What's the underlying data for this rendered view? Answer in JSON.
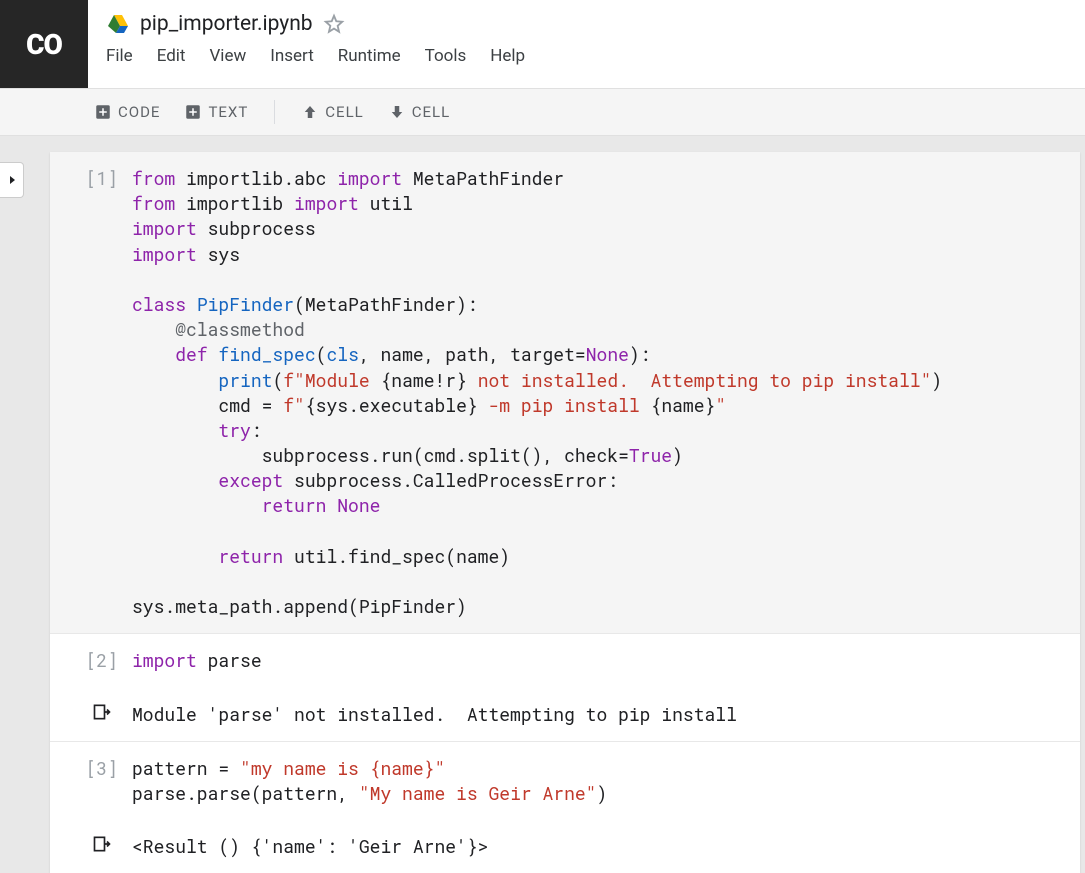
{
  "header": {
    "title": "pip_importer.ipynb",
    "logo": "CO"
  },
  "menubar": {
    "file": "File",
    "edit": "Edit",
    "view": "View",
    "insert": "Insert",
    "runtime": "Runtime",
    "tools": "Tools",
    "help": "Help"
  },
  "toolbar": {
    "code": "CODE",
    "text": "TEXT",
    "cell_up": "CELL",
    "cell_down": "CELL"
  },
  "cells": {
    "c1": {
      "prompt": "[1]"
    },
    "c2": {
      "prompt": "[2]"
    },
    "c2out": {
      "text": "Module 'parse' not installed.  Attempting to pip install"
    },
    "c3": {
      "prompt": "[3]"
    },
    "c3out": {
      "text": "<Result () {'name': 'Geir Arne'}>"
    }
  },
  "code": {
    "c1_l1_kw1": "from",
    "c1_l1_mod": " importlib.abc ",
    "c1_l1_kw2": "import",
    "c1_l1_name": " MetaPathFinder",
    "c1_l2_kw1": "from",
    "c1_l2_mod": " importlib ",
    "c1_l2_kw2": "import",
    "c1_l2_name": " util",
    "c1_l3_kw": "import",
    "c1_l3_name": " subprocess",
    "c1_l4_kw": "import",
    "c1_l4_name": " sys",
    "c1_l6_kw": "class",
    "c1_l6_name": " PipFinder",
    "c1_l6_rest": "(MetaPathFinder):",
    "c1_l7": "    @classmethod",
    "c1_l8_pad": "    ",
    "c1_l8_kw": "def",
    "c1_l8_name": " find_spec",
    "c1_l8_sig1": "(",
    "c1_l8_cls": "cls",
    "c1_l8_sig2": ", name, path, target=",
    "c1_l8_none": "None",
    "c1_l8_sig3": "):",
    "c1_l9_pad": "        ",
    "c1_l9_fn": "print",
    "c1_l9_p1": "(",
    "c1_l9_f": "f",
    "c1_l9_s1": "\"Module ",
    "c1_l9_i1": "{name!r}",
    "c1_l9_s2": " not installed.  Attempting to pip install\"",
    "c1_l9_p2": ")",
    "c1_l10_pad": "        ",
    "c1_l10_lhs": "cmd = ",
    "c1_l10_f": "f",
    "c1_l10_s1": "\"",
    "c1_l10_i1": "{sys.executable}",
    "c1_l10_s2": " -m pip install ",
    "c1_l10_i2": "{name}",
    "c1_l10_s3": "\"",
    "c1_l11_pad": "        ",
    "c1_l11_kw": "try",
    "c1_l11_c": ":",
    "c1_l12_pad": "            ",
    "c1_l12_body": "subprocess.run(cmd.split(), check=",
    "c1_l12_true": "True",
    "c1_l12_end": ")",
    "c1_l13_pad": "        ",
    "c1_l13_kw": "except",
    "c1_l13_rest": " subprocess.CalledProcessError:",
    "c1_l14_pad": "            ",
    "c1_l14_kw": "return",
    "c1_l14_none": " None",
    "c1_l16_pad": "        ",
    "c1_l16_kw": "return",
    "c1_l16_rest": " util.find_spec(name)",
    "c1_l18": "sys.meta_path.append(PipFinder)",
    "c2_kw": "import",
    "c2_name": " parse",
    "c3_l1_lhs": "pattern = ",
    "c3_l1_str": "\"my name is {name}\"",
    "c3_l2_call": "parse.parse(pattern, ",
    "c3_l2_str": "\"My name is Geir Arne\"",
    "c3_l2_end": ")"
  }
}
